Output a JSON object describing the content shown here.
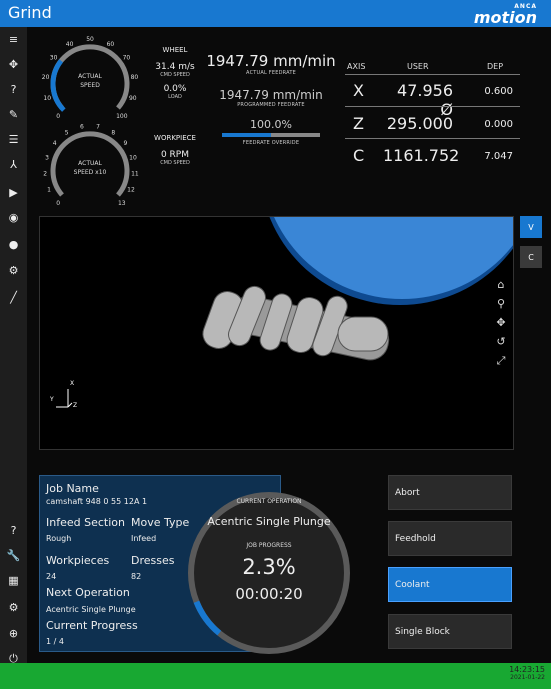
{
  "header": {
    "title": "Grind",
    "brand_small": "ANCA",
    "brand_big": "motion"
  },
  "sidebar": {
    "icons": [
      "menu-icon",
      "move-icon",
      "help-icon",
      "pencil-icon",
      "list-icon",
      "chart-icon",
      "play-icon",
      "eye-icon",
      "record-icon",
      "gear-icon",
      "ruler-icon",
      "question-icon",
      "wrench-icon",
      "calculator-icon",
      "settings-icon",
      "globe-icon",
      "power-icon"
    ]
  },
  "gauges": {
    "wheel": {
      "label_top": "ACTUAL",
      "label_bottom": "SPEED",
      "ticks": [
        "0",
        "10",
        "20",
        "30",
        "40",
        "50",
        "60",
        "70",
        "80",
        "90",
        "100"
      ],
      "value_fraction": 0.31
    },
    "workpiece": {
      "label_top": "ACTUAL",
      "label_bottom": "SPEED x10",
      "ticks": [
        "0",
        "1",
        "2",
        "3",
        "4",
        "5",
        "6",
        "7",
        "8",
        "9",
        "10",
        "11",
        "12",
        "13"
      ],
      "value_fraction": 0.0
    }
  },
  "wheel_info": {
    "heading": "WHEEL",
    "speed": "31.4 m/s",
    "speed_sub": "CMD SPEED",
    "load": "0.0%",
    "load_sub": "LOAD"
  },
  "workpiece_info": {
    "heading": "WORKPIECE",
    "speed": "0 RPM",
    "speed_sub": "CMD SPEED"
  },
  "feed": {
    "actual": "1947.79 mm/min",
    "actual_label": "ACTUAL FEEDRATE",
    "programmed": "1947.79 mm/min",
    "programmed_label": "PROGRAMMED FEEDRATE",
    "override": "100.0%",
    "override_label": "FEEDRATE OVERRIDE",
    "override_fraction": 0.5
  },
  "axis_table": {
    "headers": {
      "axis": "AXIS",
      "user": "USER",
      "dep": "DEP"
    },
    "rows": [
      {
        "axis": "X",
        "user": "47.956 Ø",
        "dep": "0.600"
      },
      {
        "axis": "Z",
        "user": "295.000",
        "dep": "0.000"
      },
      {
        "axis": "C",
        "user": "1161.752",
        "dep": "7.047"
      }
    ]
  },
  "view_buttons": {
    "v": "V",
    "c": "C"
  },
  "job": {
    "job_name_label": "Job Name",
    "job_name": "camshaft 948 0 55 12A 1",
    "infeed_section_label": "Infeed Section",
    "infeed_section": "Rough",
    "move_type_label": "Move Type",
    "move_type": "Infeed",
    "workpieces_label": "Workpieces",
    "workpieces": "24",
    "dresses_label": "Dresses",
    "dresses": "82",
    "next_op_label": "Next Operation",
    "next_op": "Acentric Single Plunge",
    "current_progress_label": "Current Progress",
    "current_progress": "1 / 4"
  },
  "current_op": {
    "label": "CURRENT OPERATION",
    "name": "Acentric Single Plunge",
    "progress_label": "JOB PROGRESS",
    "progress": "2.3%",
    "progress_fraction": 0.023,
    "time": "00:00:20"
  },
  "actions": [
    {
      "label": "Abort",
      "active": false
    },
    {
      "label": "Feedhold",
      "active": false
    },
    {
      "label": "Coolant",
      "active": true
    },
    {
      "label": "Single Block",
      "active": false
    }
  ],
  "clock": {
    "time": "14:23:15",
    "date": "2021-01-22"
  },
  "colors": {
    "accent": "#1878d0",
    "footer": "#18a832",
    "panel": "#0e3050"
  }
}
